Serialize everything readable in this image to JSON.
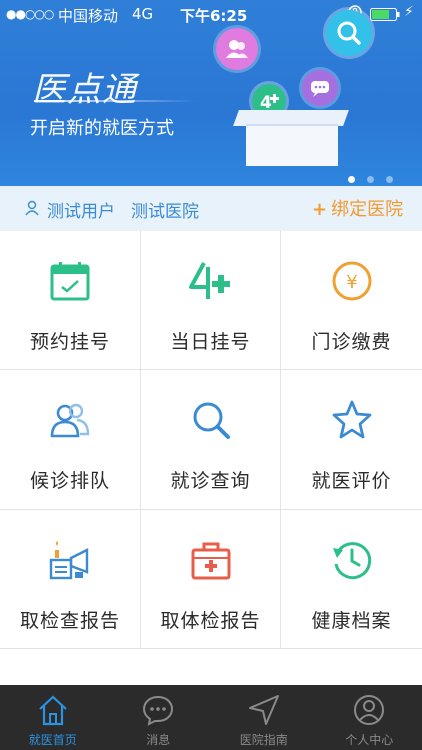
{
  "status_bar": {
    "signal": "●●○○○",
    "carrier": "中国移动",
    "network": "4G",
    "time": "下午6:25"
  },
  "banner": {
    "logo_text": "医点通",
    "slogan": "开启新的就医方式",
    "carousel_pages": 3,
    "active_page": 1
  },
  "user_bar": {
    "user_name": "测试用户",
    "hospital_name": "测试医院",
    "bind_label": "绑定医院",
    "bind_plus": "+"
  },
  "grid": {
    "items": [
      {
        "label": "预约挂号",
        "icon": "calendar-icon"
      },
      {
        "label": "当日挂号",
        "icon": "four-plus-icon"
      },
      {
        "label": "门诊缴费",
        "icon": "yuan-coin-icon"
      },
      {
        "label": "候诊排队",
        "icon": "people-queue-icon"
      },
      {
        "label": "就诊查询",
        "icon": "search-icon"
      },
      {
        "label": "就医评价",
        "icon": "star-icon"
      },
      {
        "label": "取检查报告",
        "icon": "test-report-icon"
      },
      {
        "label": "取体检报告",
        "icon": "medical-kit-icon"
      },
      {
        "label": "健康档案",
        "icon": "clock-history-icon"
      }
    ]
  },
  "tab_bar": {
    "tabs": [
      {
        "label": "就医首页",
        "icon": "home-icon",
        "active": true
      },
      {
        "label": "消息",
        "icon": "chat-icon",
        "active": false
      },
      {
        "label": "医院指南",
        "icon": "navigation-icon",
        "active": false
      },
      {
        "label": "个人中心",
        "icon": "person-icon",
        "active": false
      }
    ]
  },
  "colors": {
    "banner_blue": "#2f7fd8",
    "accent_blue": "#3b8ad2",
    "bind_orange": "#f39a30",
    "icon_green": "#2dbf8a",
    "icon_orange": "#f0a030",
    "icon_red": "#e85c4a",
    "tabbar_bg": "#2b2b2b",
    "tab_active": "#2b93e0"
  }
}
